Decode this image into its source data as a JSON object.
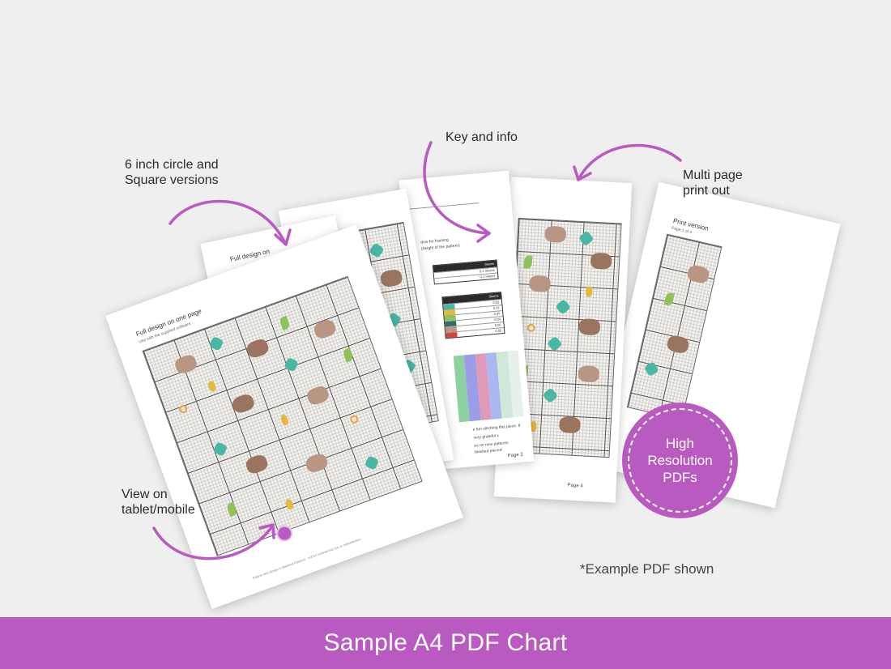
{
  "colors": {
    "accent": "#b95ac0",
    "background": "#efefef",
    "text": "#2b2b2b",
    "grid_line": "#555555",
    "capybara": "#b99583",
    "turtle": "#48b7a4",
    "leaf": "#8fc25a",
    "pineapple": "#e6b83c"
  },
  "callouts": {
    "circle_square": [
      "6 inch circle and",
      "Square versions"
    ],
    "key_info": "Key and info",
    "multi_page": [
      "Multi page",
      "print out"
    ],
    "tablet": [
      "View on",
      "tablet/mobile"
    ]
  },
  "pages": {
    "full_design": {
      "heading": "Full design on one page",
      "sub": "Use with the supplied software",
      "footnote": "Pattern and design © Stitched Patterns - not for commercial use or redistribution"
    },
    "back_sheet": {
      "heading": "Full design on"
    },
    "key_page": {
      "line_a": "dow for framing",
      "line_b": "(height of the pattern)",
      "table_top_head": "Skeins",
      "table_top_rows": [
        "0.2 Skeins",
        "0.1 Skeins"
      ],
      "table_main_head": "Skeins",
      "table_main_rows": [
        "0.03",
        "0.07",
        "0.05",
        "0.04",
        "0.06",
        "0.05"
      ],
      "thanks_lines": [
        "e fun stitching this piece. If",
        "very grateful x",
        "es on new patterns",
        "finished pieces!"
      ],
      "page_number": "Page 2"
    },
    "chart_page": {
      "page_number": "Page 4"
    },
    "print_version": {
      "heading": "Print version",
      "sub": "Page 1 of 4"
    }
  },
  "badge": [
    "High",
    "Resolution",
    "PDFs"
  ],
  "example_note": "*Example PDF shown",
  "banner": {
    "title": "Sample A4 PDF Chart"
  }
}
